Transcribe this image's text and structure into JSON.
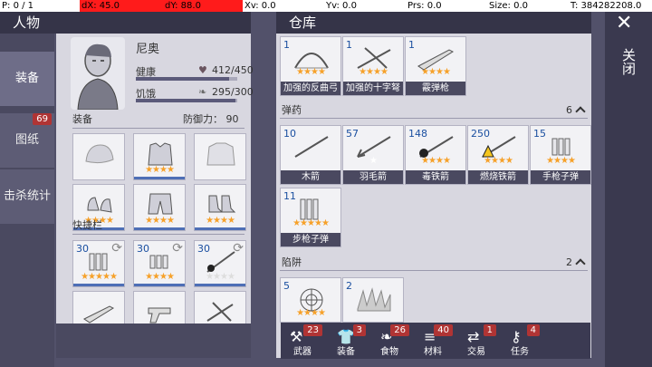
{
  "debug": {
    "p": "P: 0 / 1",
    "dx": "dX: 45.0",
    "dy": "dY: 88.0",
    "xv": "Xv: 0.0",
    "yv": "Yv: 0.0",
    "prs": "Prs: 0.0",
    "size": "Size: 0.0",
    "t": "T: 384282208.0"
  },
  "character": {
    "tab_title": "人物",
    "name": "尼奥",
    "health_label": "健康",
    "health_value": "412/450",
    "health_fraction": 0.92,
    "hunger_label": "饥饿",
    "hunger_value": "295/300",
    "hunger_fraction": 0.98,
    "equip_label": "装备",
    "defense_label": "防御力：",
    "defense_value": "90",
    "quickbar_label": "快捷栏",
    "equip_slots": [
      {
        "icon": "hat-icon",
        "stars": ""
      },
      {
        "icon": "armor-vest-icon",
        "stars": "★★★★"
      },
      {
        "icon": "jacket-icon",
        "stars": ""
      },
      {
        "icon": "gloves-icon",
        "stars": "★★★★"
      },
      {
        "icon": "pants-icon",
        "stars": "★★★★"
      },
      {
        "icon": "boots-icon",
        "stars": "★★★★"
      }
    ],
    "quick_slots": [
      {
        "icon": "rifle-bullets-icon",
        "count": "30",
        "stars": "★★★★★"
      },
      {
        "icon": "pistol-bullets-icon",
        "count": "30",
        "stars": "★★★★"
      },
      {
        "icon": "poison-arrow-icon",
        "count": "30",
        "stars": "★★★★"
      },
      {
        "icon": "rifle-icon",
        "count": "",
        "stars": "★★★★★"
      },
      {
        "icon": "revolver-icon",
        "count": "",
        "stars": "★★★★"
      },
      {
        "icon": "crossbow-icon",
        "count": "",
        "stars": "★★★★"
      }
    ]
  },
  "side_tabs": [
    {
      "label": "装备",
      "badge": ""
    },
    {
      "label": "图纸",
      "badge": "69"
    },
    {
      "label": "击杀统计",
      "badge": ""
    }
  ],
  "storage": {
    "title": "仓库",
    "weapons": [
      {
        "name": "加强的反曲弓",
        "count": "1",
        "stars": "★★★★",
        "icon": "bow-icon"
      },
      {
        "name": "加强的十字弩",
        "count": "1",
        "stars": "★★★★",
        "icon": "crossbow-icon"
      },
      {
        "name": "霰弹枪",
        "count": "1",
        "stars": "★★★★",
        "icon": "shotgun-icon"
      }
    ],
    "ammo_label": "弹药",
    "ammo_count": "6",
    "ammo": [
      {
        "name": "木箭",
        "count": "10",
        "stars": "",
        "icon": "wood-arrow-icon"
      },
      {
        "name": "羽毛箭",
        "count": "57",
        "stars": "★",
        "icon": "feather-arrow-icon"
      },
      {
        "name": "毒铁箭",
        "count": "148",
        "stars": "★★★★",
        "icon": "poison-arrow-icon"
      },
      {
        "name": "燃烧铁箭",
        "count": "250",
        "stars": "★★★★",
        "icon": "fire-arrow-icon"
      },
      {
        "name": "手枪子弹",
        "count": "15",
        "stars": "★★★★",
        "icon": "pistol-bullets-icon"
      },
      {
        "name": "步枪子弹",
        "count": "11",
        "stars": "★★★★★",
        "icon": "rifle-bullets-icon"
      }
    ],
    "traps_label": "陷阱",
    "traps_count": "2",
    "traps": [
      {
        "count": "5",
        "stars": "★★★★",
        "icon": "net-trap-icon"
      },
      {
        "count": "2",
        "stars": "",
        "icon": "spike-trap-icon"
      }
    ],
    "bottom_tabs": [
      {
        "label": "武器",
        "badge": "23",
        "icon": "axe-icon"
      },
      {
        "label": "装备",
        "badge": "3",
        "icon": "shirt-icon"
      },
      {
        "label": "食物",
        "badge": "26",
        "icon": "food-icon"
      },
      {
        "label": "材料",
        "badge": "40",
        "icon": "logs-icon"
      },
      {
        "label": "交易",
        "badge": "1",
        "icon": "trade-icon"
      },
      {
        "label": "任务",
        "badge": "4",
        "icon": "key-icon"
      }
    ]
  },
  "close": {
    "label": "关闭",
    "icon": "close-icon"
  }
}
